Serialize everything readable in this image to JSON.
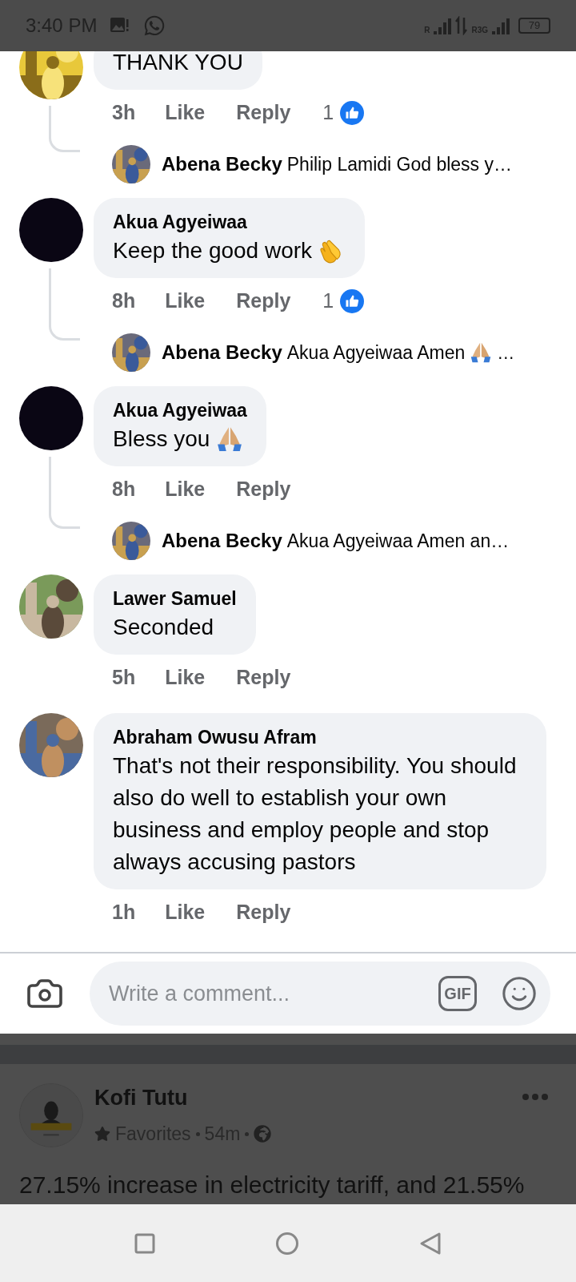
{
  "status_bar": {
    "time": "3:40 PM",
    "sim1_label": "R",
    "sim2_label": "R3G",
    "battery": "79"
  },
  "comments": [
    {
      "body": "THANK YOU",
      "time": "3h",
      "like": "Like",
      "reply": "Reply",
      "likes": "1",
      "reply_preview": {
        "author": "Abena Becky",
        "text": "Philip Lamidi God bless y…"
      }
    },
    {
      "avatar": {
        "kind": "blank"
      },
      "name": "Akua Agyeiwaa",
      "body": "Keep the good work",
      "emoji": {
        "kind": "clap"
      },
      "time": "8h",
      "like": "Like",
      "reply": "Reply",
      "likes": "1",
      "reply_preview": {
        "author": "Abena Becky",
        "text": "Akua Agyeiwaa Amen",
        "emoji": {
          "kind": "pray"
        },
        "tail": "…"
      }
    },
    {
      "avatar": {
        "kind": "blank"
      },
      "name": "Akua Agyeiwaa",
      "body": "Bless you",
      "emoji": {
        "kind": "pray"
      },
      "time": "8h",
      "like": "Like",
      "reply": "Reply",
      "reply_preview": {
        "author": "Abena Becky",
        "text": "Akua Agyeiwaa Amen an…"
      }
    },
    {
      "name": "Lawer Samuel",
      "body": "Seconded",
      "time": "5h",
      "like": "Like",
      "reply": "Reply"
    },
    {
      "name": "Abraham Owusu Afram",
      "body": "That's not their responsibility. You should also do well to establish your own business and employ people and stop always accusing pastors",
      "time": "1h",
      "like": "Like",
      "reply": "Reply"
    }
  ],
  "composer": {
    "placeholder": "Write a comment...",
    "gif": "GIF"
  },
  "next_post": {
    "author": "Kofi Tutu",
    "audience": "Favorites",
    "time": "54m",
    "text": "27.15% increase in electricity tariff, and 21.55%"
  }
}
